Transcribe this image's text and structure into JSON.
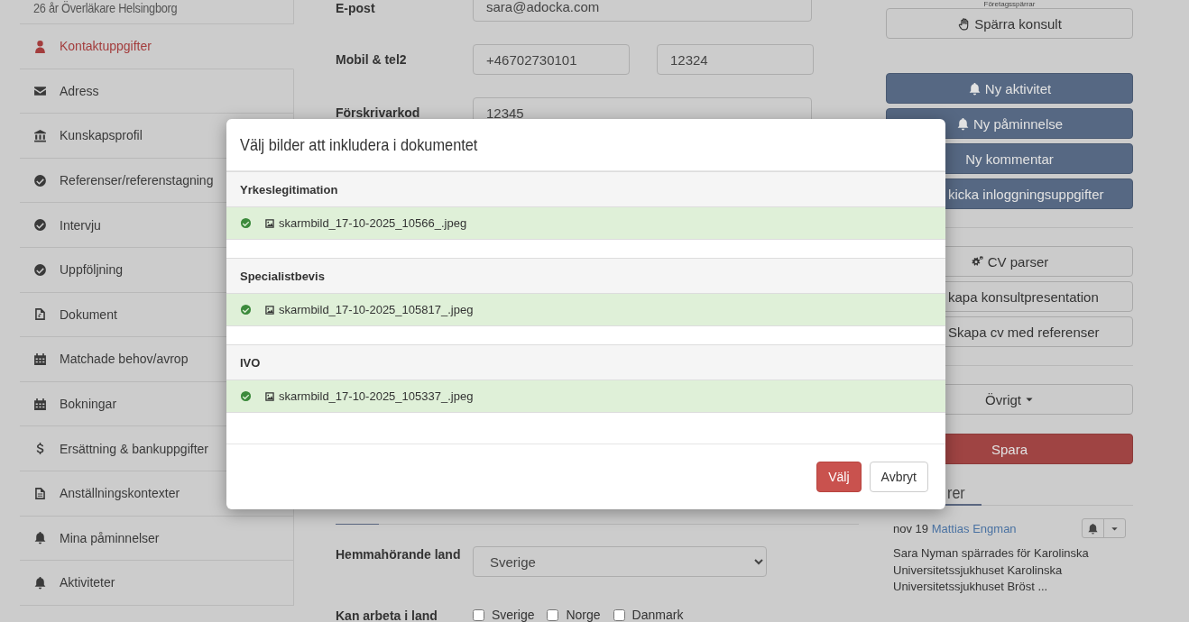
{
  "sidebar": {
    "header": "26 år Överläkare Helsingborg",
    "items": [
      {
        "label": "Kontaktuppgifter",
        "selected": true
      },
      {
        "label": "Adress",
        "selected": false
      },
      {
        "label": "Kunskapsprofil",
        "selected": false
      },
      {
        "label": "Referenser/referenstagning",
        "selected": false
      },
      {
        "label": "Intervju",
        "selected": false
      },
      {
        "label": "Uppföljning",
        "selected": false
      },
      {
        "label": "Dokument",
        "selected": false
      },
      {
        "label": "Matchade behov/avrop",
        "selected": false
      },
      {
        "label": "Bokningar",
        "selected": false
      },
      {
        "label": "Ersättning & bankuppgifter",
        "selected": false
      },
      {
        "label": "Anställningskontexter",
        "selected": false
      },
      {
        "label": "Mina påminnelser",
        "selected": false
      },
      {
        "label": "Aktiviteter",
        "selected": false
      }
    ]
  },
  "form": {
    "fields": [
      {
        "label": "E-post",
        "values": [
          "sara@adocka.com"
        ]
      },
      {
        "label": "Mobil & tel2",
        "values": [
          "+46702730101",
          "12324"
        ]
      },
      {
        "label": "Förskrivarkod",
        "values": [
          "12345"
        ]
      }
    ],
    "home_country": {
      "label": "Hemmahörande land",
      "value": "Sverige"
    },
    "work_countries": {
      "label": "Kan arbeta i land",
      "options": [
        {
          "label": "Sverige",
          "checked": false
        },
        {
          "label": "Norge",
          "checked": false
        },
        {
          "label": "Danmark",
          "checked": false
        }
      ]
    }
  },
  "actions": {
    "caption": "Företagsspärrar",
    "blocks": [
      {
        "divider": false,
        "buttons": [
          {
            "label": "Spärra konsult",
            "kind": "default"
          }
        ]
      },
      {
        "divider": false,
        "buttons": [
          {
            "label": "Ny aktivitet",
            "kind": "primary"
          },
          {
            "label": "Ny påminnelse",
            "kind": "primary"
          },
          {
            "label": "Ny kommentar",
            "kind": "primary"
          },
          {
            "label": "kicka inloggningsuppgifter",
            "kind": "primary"
          }
        ]
      },
      {
        "divider": true,
        "buttons": [
          {
            "label": "CV parser",
            "kind": "default"
          },
          {
            "label": "kapa konsultpresentation",
            "kind": "default"
          },
          {
            "label": "Skapa cv med referenser",
            "kind": "default"
          }
        ]
      },
      {
        "divider": true,
        "buttons": [
          {
            "label": "Övrigt",
            "kind": "dropdown"
          }
        ]
      },
      {
        "divider": false,
        "buttons": [
          {
            "label": "Spara",
            "kind": "danger"
          }
        ]
      }
    ]
  },
  "comments": {
    "heading": "rer",
    "items": [
      {
        "date": "nov 19",
        "author": "Mattias Engman",
        "text": "Sara Nyman spärrades för Karolinska Universitetssjukhuset Karolinska Universitetssjukhuset Bröst ..."
      }
    ]
  },
  "modal": {
    "title": "Välj bilder att inkludera i dokumentet",
    "groups": [
      {
        "title": "Yrkeslegitimation",
        "files": [
          {
            "name": "skarmbild_17-10-2025_10566_.jpeg",
            "selected": true
          }
        ]
      },
      {
        "title": "Specialistbevis",
        "files": [
          {
            "name": "skarmbild_17-10-2025_105817_.jpeg",
            "selected": true
          }
        ]
      },
      {
        "title": "IVO",
        "files": [
          {
            "name": "skarmbild_17-10-2025_105337_.jpeg",
            "selected": true
          }
        ]
      }
    ],
    "buttons": [
      {
        "label": "Välj",
        "kind": "danger"
      },
      {
        "label": "Avbryt",
        "kind": "default"
      }
    ]
  }
}
